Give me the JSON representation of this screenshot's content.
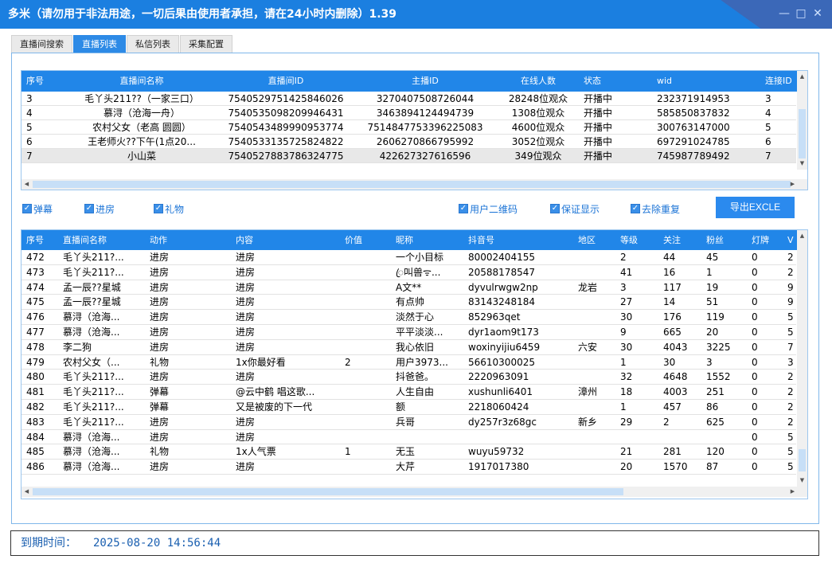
{
  "app": {
    "title": "多米（请勿用于非法用途，一切后果由使用者承担，请在24小时内删除）1.39"
  },
  "window_controls": {
    "minimize": "—",
    "maximize": "□",
    "close": "✕"
  },
  "tabs": [
    {
      "label": "直播间搜索",
      "active": false
    },
    {
      "label": "直播列表",
      "active": true
    },
    {
      "label": "私信列表",
      "active": false
    },
    {
      "label": "采集配置",
      "active": false
    }
  ],
  "rooms_table": {
    "columns": [
      "序号",
      "直播间名称",
      "直播间ID",
      "主播ID",
      "在线人数",
      "状态",
      "wid",
      "连接ID"
    ],
    "rows": [
      [
        "3",
        "毛丫头211??（一家三口）",
        "7540529751425846026",
        "3270407508726044",
        "28248位观众",
        "开播中",
        "232371914953",
        "3"
      ],
      [
        "4",
        "慕浔（沧海一舟）",
        "7540535098209946431",
        "3463894124494739",
        "1308位观众",
        "开播中",
        "585850837832",
        "4"
      ],
      [
        "5",
        "农村父女（老高 圆圆）",
        "7540543489990953774",
        "7514847753396225083",
        "4600位观众",
        "开播中",
        "300763147000",
        "5"
      ],
      [
        "6",
        "王老师火??下午(1点20...",
        "7540533135725824822",
        "2606270866795992",
        "3052位观众",
        "开播中",
        "697291024785",
        "6"
      ],
      [
        "7",
        "小山菜",
        "7540527883786324775",
        "422627327616596",
        "349位观众",
        "开播中",
        "745987789492",
        "7"
      ]
    ],
    "selected_row_index": 4
  },
  "options": [
    {
      "label": "弹幕",
      "checked": true
    },
    {
      "label": "进房",
      "checked": true
    },
    {
      "label": "礼物",
      "checked": true
    },
    {
      "label": "用户二维码",
      "checked": true
    },
    {
      "label": "保证显示",
      "checked": true
    },
    {
      "label": "去除重复",
      "checked": true
    }
  ],
  "export_button": "导出EXCLE",
  "events_table": {
    "columns": [
      "序号",
      "直播间名称",
      "动作",
      "内容",
      "价值",
      "昵称",
      "抖音号",
      "地区",
      "等级",
      "关注",
      "粉丝",
      "灯牌",
      "V"
    ],
    "rows": [
      [
        "472",
        "毛丫头211?...",
        "进房",
        "进房",
        "",
        "一个小目标",
        "80002404155",
        "",
        "2",
        "44",
        "45",
        "0",
        "2"
      ],
      [
        "473",
        "毛丫头211?...",
        "进房",
        "进房",
        "",
        "ꦿ叫兽ᯤ...",
        "20588178547",
        "",
        "41",
        "16",
        "1",
        "0",
        "2"
      ],
      [
        "474",
        "孟一辰??星城",
        "进房",
        "进房",
        "",
        "A文**",
        "dyvulrwgw2np",
        "龙岩",
        "3",
        "117",
        "19",
        "0",
        "9"
      ],
      [
        "475",
        "孟一辰??星城",
        "进房",
        "进房",
        "",
        "有点帅",
        "83143248184",
        "",
        "27",
        "14",
        "51",
        "0",
        "9"
      ],
      [
        "476",
        "慕浔（沧海...",
        "进房",
        "进房",
        "",
        "淡然于心",
        "852963qet",
        "",
        "30",
        "176",
        "119",
        "0",
        "5"
      ],
      [
        "477",
        "慕浔（沧海...",
        "进房",
        "进房",
        "",
        "平平淡淡...",
        "dyr1aom9t173",
        "",
        "9",
        "665",
        "20",
        "0",
        "5"
      ],
      [
        "478",
        "李二狗",
        "进房",
        "进房",
        "",
        "我心依旧",
        "woxinyijiu6459",
        "六安",
        "30",
        "4043",
        "3225",
        "0",
        "7"
      ],
      [
        "479",
        "农村父女（...",
        "礼物",
        "1x你最好看",
        "2",
        "用户3973...",
        "56610300025",
        "",
        "1",
        "30",
        "3",
        "0",
        "3"
      ],
      [
        "480",
        "毛丫头211?...",
        "进房",
        "进房",
        "",
        "抖爸爸。",
        "2220963091",
        "",
        "32",
        "4648",
        "1552",
        "0",
        "2"
      ],
      [
        "481",
        "毛丫头211?...",
        "弹幕",
        "@云中鹤 唱这歌...",
        "",
        "人生自由",
        "xushunli6401",
        "漳州",
        "18",
        "4003",
        "251",
        "0",
        "2"
      ],
      [
        "482",
        "毛丫头211?...",
        "弹幕",
        "又是被废的下一代",
        "",
        "额",
        "2218060424",
        "",
        "1",
        "457",
        "86",
        "0",
        "2"
      ],
      [
        "483",
        "毛丫头211?...",
        "进房",
        "进房",
        "",
        "兵哥",
        "dy257r3z68gc",
        "新乡",
        "29",
        "2",
        "625",
        "0",
        "2"
      ],
      [
        "484",
        "慕浔（沧海...",
        "进房",
        "进房",
        "",
        "",
        "",
        "",
        "",
        "",
        "",
        "0",
        "5"
      ],
      [
        "485",
        "慕浔（沧海...",
        "礼物",
        "1x人气票",
        "1",
        "无玉",
        "wuyu59732",
        "",
        "21",
        "281",
        "120",
        "0",
        "5"
      ],
      [
        "486",
        "慕浔（沧海...",
        "进房",
        "进房",
        "",
        "大芹",
        "1917017380",
        "",
        "20",
        "1570",
        "87",
        "0",
        "5"
      ]
    ]
  },
  "status": {
    "expiry_label": "到期时间：",
    "expiry_value": "2025-08-20 14:56:44"
  },
  "colors": {
    "accent": "#2186e8",
    "titlebar": "#1b7fe0",
    "tab_active": "#2d8ae6",
    "checkbox": "#3a8fe8",
    "status_text": "#1a5fb0"
  }
}
